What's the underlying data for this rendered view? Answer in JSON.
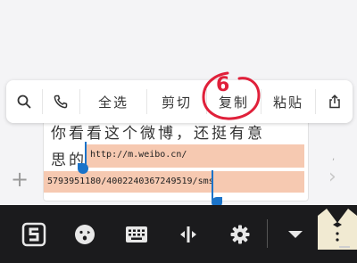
{
  "message": {
    "line1": "你看看这个微博，还挺有意",
    "line2_start": "思的",
    "url_part1": "http://m.weibo.cn/",
    "url_part2": "5793951180/4002240367249519/sms"
  },
  "context_menu": {
    "items": [
      {
        "id": "search",
        "icon": "search-icon"
      },
      {
        "id": "call",
        "icon": "phone-icon"
      },
      {
        "id": "select_all",
        "label": "全选"
      },
      {
        "id": "cut",
        "label": "剪切"
      },
      {
        "id": "copy",
        "label": "复制"
      },
      {
        "id": "paste",
        "label": "粘贴"
      },
      {
        "id": "share",
        "icon": "share-icon"
      }
    ],
    "annotation": "6",
    "annotation_color": "#e0203a"
  },
  "keyboard_toolbar": {
    "items": [
      "sogou-logo-icon",
      "emoji-icon",
      "keyboard-icon",
      "cursor-move-icon",
      "settings-gear-icon",
      "collapse-icon"
    ],
    "selection_color": "#f6c9b1",
    "handle_color": "#1a73c9"
  }
}
